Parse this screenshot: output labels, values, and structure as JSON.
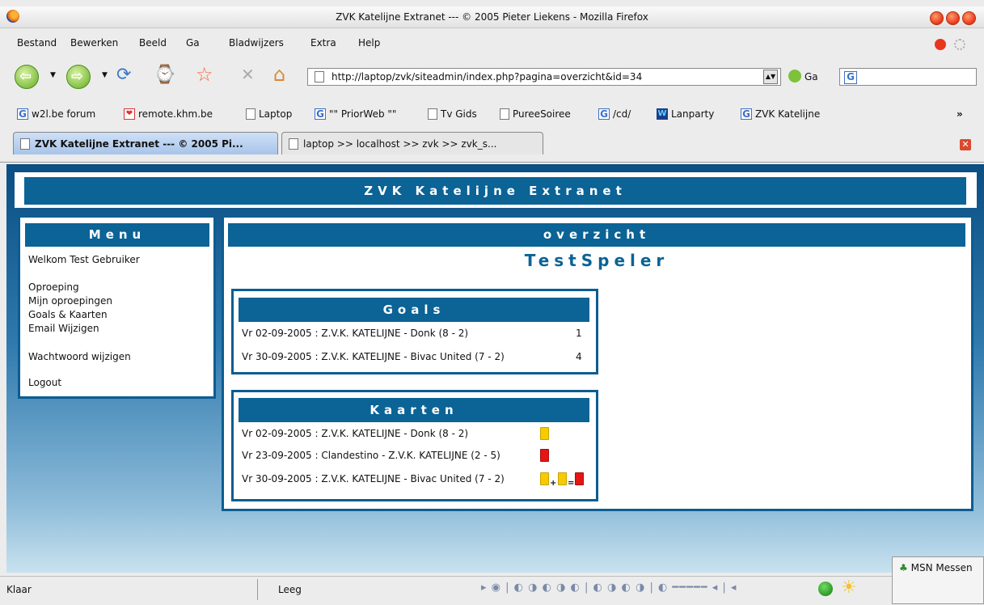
{
  "window": {
    "title": "ZVK Katelijne Extranet --- © 2005 Pieter Liekens - Mozilla Firefox"
  },
  "menubar": {
    "items": [
      "Bestand",
      "Bewerken",
      "Beeld",
      "Ga",
      "Bladwijzers",
      "Extra",
      "Help"
    ]
  },
  "navbar": {
    "url": "http://laptop/zvk/siteadmin/index.php?pagina=overzicht&id=34",
    "go_label": "Ga"
  },
  "bookmarks": [
    {
      "label": "w2l.be forum",
      "icon": "google-icon"
    },
    {
      "label": "remote.khm.be",
      "icon": "remote-icon"
    },
    {
      "label": "Laptop",
      "icon": "page-icon"
    },
    {
      "label": "\"\" PriorWeb \"\"",
      "icon": "google-icon"
    },
    {
      "label": "Tv Gids",
      "icon": "page-icon"
    },
    {
      "label": "PureeSoiree",
      "icon": "page-icon"
    },
    {
      "label": "/cd/",
      "icon": "google-icon"
    },
    {
      "label": "Lanparty",
      "icon": "lanparty-icon"
    },
    {
      "label": "ZVK Katelijne",
      "icon": "google-icon"
    }
  ],
  "bookmarks_more": "»",
  "tabs": [
    {
      "label": "ZVK Katelijne Extranet --- © 2005 Pi..."
    },
    {
      "label": "laptop >> localhost >> zvk >> zvk_s..."
    }
  ],
  "site": {
    "title": "ZVK Katelijne Extranet"
  },
  "menu": {
    "title": "Menu",
    "welcome": "Welkom Test Gebruiker",
    "links": [
      "Oproeping",
      "Mijn oproepingen",
      "Goals & Kaarten",
      "Email Wijzigen"
    ],
    "password": "Wachtwoord wijzigen",
    "logout": "Logout"
  },
  "main": {
    "title": "overzicht",
    "player": "TestSpeler",
    "goals_title": "Goals",
    "goals": [
      {
        "match": "Vr 02-09-2005 : Z.V.K. KATELIJNE - Donk (8 - 2)",
        "count": "1"
      },
      {
        "match": "Vr 30-09-2005 : Z.V.K. KATELIJNE - Bivac United (7 - 2)",
        "count": "4"
      }
    ],
    "cards_title": "Kaarten",
    "cards": [
      {
        "match": "Vr 02-09-2005 : Z.V.K. KATELIJNE - Donk (8 - 2)",
        "cards": "yellow"
      },
      {
        "match": "Vr 23-09-2005 : Clandestino - Z.V.K. KATELIJNE (2 - 5)",
        "cards": "red"
      },
      {
        "match": "Vr 30-09-2005 : Z.V.K. KATELIJNE - Bivac United (7 - 2)",
        "cards": "yellow + yellow = red"
      }
    ]
  },
  "statusbar": {
    "left": "Klaar",
    "middle": "Leeg"
  },
  "msn": {
    "label": "MSN Messen"
  },
  "colors": {
    "accent": "#0b6396",
    "yellow_card": "#f6cb00",
    "red_card": "#e51515"
  }
}
